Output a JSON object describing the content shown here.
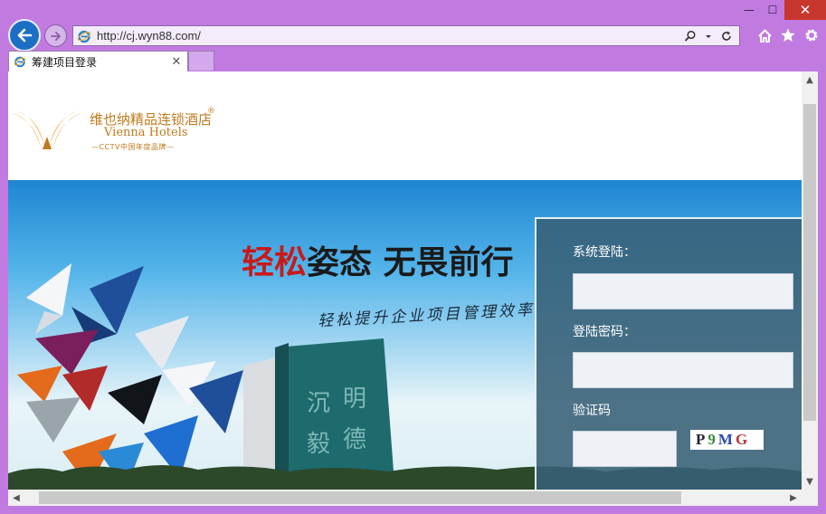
{
  "browser": {
    "url": "http://cj.wyn88.com/",
    "tab_title": "筹建项目登录",
    "window_controls": {
      "minimize": "—",
      "maximize": "☐",
      "close": "✕"
    },
    "tab_close": "✕",
    "icons": [
      "back-arrow-icon",
      "forward-arrow-icon",
      "ie-logo-icon",
      "search-icon",
      "refresh-icon",
      "home-icon",
      "favorites-star-icon",
      "settings-gear-icon"
    ]
  },
  "page": {
    "logo": {
      "cn": "维也纳精品连锁酒店",
      "reg": "®",
      "en": "Vienna Hotels",
      "sub": "—CCTV中国年度品牌—"
    },
    "banner": {
      "slogan_red": "轻松",
      "slogan_rest": "姿态 无畏前行",
      "sub_slogan": "轻松提升企业项目管理效率"
    },
    "login": {
      "system_login_label": "系统登陆：",
      "password_label": "登陆密码：",
      "captcha_label": "验证码",
      "username_value": "",
      "password_value": "",
      "captcha_value": "",
      "captcha_chars": [
        "P",
        "9",
        "M",
        "G"
      ]
    }
  },
  "scrollbars": {
    "up": "▲",
    "down": "▼",
    "left": "◀",
    "right": "▶"
  },
  "colors": {
    "chrome": "#c17be0",
    "accent_blue": "#1c6fc4",
    "logo_gold": "#c07a1c",
    "slogan_red": "#c71a1a",
    "panel": "#386076"
  }
}
